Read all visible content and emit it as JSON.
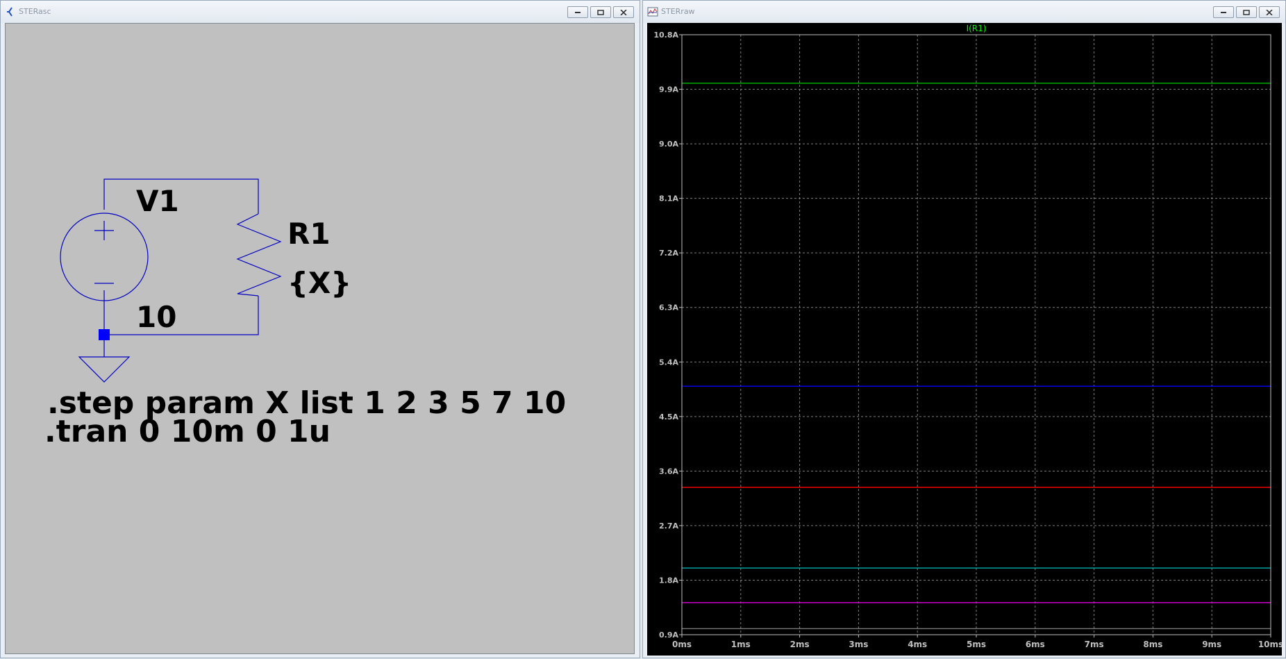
{
  "schematic_window": {
    "title": "STERasc",
    "source_label": "V1",
    "source_value": "10",
    "resistor_label": "R1",
    "resistor_value": "{X}",
    "directive_step": ".step param X list 1 2 3 5 7 10",
    "directive_tran": ".tran 0 10m 0 1u"
  },
  "waveform_window": {
    "title": "STERraw"
  },
  "colors": {
    "schematic_bg": "#c0c0c0",
    "wire": "#0000c0",
    "node_dot": "#0000ff",
    "plot_bg": "#000000",
    "grid": "#808080",
    "trace_label": "#00ff00"
  },
  "chart_data": {
    "type": "line",
    "title": "I(R1)",
    "x": [
      0,
      10
    ],
    "xlim": [
      0,
      10
    ],
    "ylim": [
      0.9,
      10.8
    ],
    "x_tick_labels": [
      "0ms",
      "1ms",
      "2ms",
      "3ms",
      "4ms",
      "5ms",
      "6ms",
      "7ms",
      "8ms",
      "9ms",
      "10ms"
    ],
    "y_ticks": [
      0.9,
      1.8,
      2.7,
      3.6,
      4.5,
      5.4,
      6.3,
      7.2,
      8.1,
      9.0,
      9.9,
      10.8
    ],
    "y_tick_labels": [
      "0.9A",
      "1.8A",
      "2.7A",
      "3.6A",
      "4.5A",
      "5.4A",
      "6.3A",
      "7.2A",
      "8.1A",
      "9.0A",
      "9.9A",
      "10.8A"
    ],
    "grid": true,
    "series": [
      {
        "values": [
          10,
          10
        ],
        "color": "#00c000"
      },
      {
        "values": [
          5,
          5
        ],
        "color": "#0000ff"
      },
      {
        "values": [
          3.333,
          3.333
        ],
        "color": "#ff0000"
      },
      {
        "values": [
          2,
          2
        ],
        "color": "#00c0c0"
      },
      {
        "values": [
          1.429,
          1.429
        ],
        "color": "#e000e0"
      },
      {
        "values": [
          1,
          1
        ],
        "color": "#808080"
      }
    ]
  }
}
